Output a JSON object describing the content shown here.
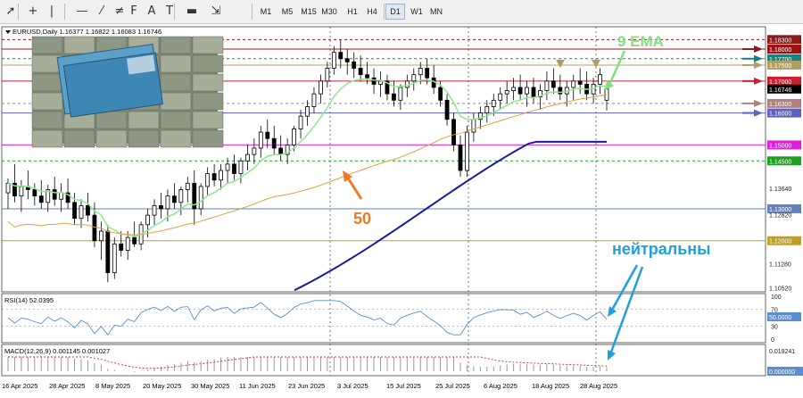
{
  "toolbar": {
    "tools": [
      {
        "name": "cursor-icon",
        "glyph": "➚"
      },
      {
        "name": "crosshair-icon",
        "glyph": "+"
      },
      {
        "name": "vertical-line-icon",
        "glyph": "|"
      },
      {
        "name": "horizontal-line-icon",
        "glyph": "—"
      },
      {
        "name": "trendline-icon",
        "glyph": "⁄"
      },
      {
        "name": "channel-icon",
        "glyph": "≠"
      },
      {
        "name": "fibonacci-icon",
        "glyph": "F"
      },
      {
        "name": "text-icon",
        "glyph": "A"
      },
      {
        "name": "label-icon",
        "glyph": "T"
      },
      {
        "name": "shapes-icon",
        "glyph": "▬"
      },
      {
        "name": "arrows-icon",
        "glyph": "⇲"
      }
    ],
    "timeframes": [
      "M1",
      "M5",
      "M15",
      "M30",
      "H1",
      "H4",
      "D1",
      "W1",
      "MN"
    ],
    "active_timeframe": "D1"
  },
  "chart_info": "EURUSD,Daily  1.16377 1.16822 1.16083 1.16746",
  "chart_data": {
    "type": "candlestick",
    "symbol": "EURUSD",
    "timeframe": "Daily",
    "ohlc_last": {
      "open": 1.16377,
      "high": 1.16822,
      "low": 1.16083,
      "close": 1.16746
    },
    "ylim": [
      1.104,
      1.187
    ],
    "x_labels": [
      "16 Apr 2025",
      "28 Apr 2025",
      "8 May 2025",
      "20 May 2025",
      "30 May 2025",
      "11 Jun 2025",
      "23 Jun 2025",
      "3 Jul 2025",
      "15 Jul 2025",
      "25 Jul 2025",
      "6 Aug 2025",
      "18 Aug 2025",
      "28 Aug 2025"
    ],
    "price_ticks": [
      1.1364,
      1.1282,
      1.1128,
      1.1052
    ],
    "candles": [
      [
        1.135,
        1.1395,
        1.13,
        1.138
      ],
      [
        1.138,
        1.144,
        1.132,
        1.134
      ],
      [
        1.134,
        1.139,
        1.129,
        1.137
      ],
      [
        1.137,
        1.142,
        1.133,
        1.136
      ],
      [
        1.136,
        1.138,
        1.131,
        1.134
      ],
      [
        1.134,
        1.139,
        1.13,
        1.132
      ],
      [
        1.132,
        1.1375,
        1.129,
        1.136
      ],
      [
        1.136,
        1.14,
        1.131,
        1.133
      ],
      [
        1.133,
        1.138,
        1.129,
        1.135
      ],
      [
        1.135,
        1.1395,
        1.13,
        1.132
      ],
      [
        1.132,
        1.135,
        1.125,
        1.127
      ],
      [
        1.127,
        1.133,
        1.124,
        1.131
      ],
      [
        1.131,
        1.135,
        1.126,
        1.128
      ],
      [
        1.128,
        1.132,
        1.118,
        1.12
      ],
      [
        1.12,
        1.126,
        1.114,
        1.123
      ],
      [
        1.123,
        1.125,
        1.107,
        1.11
      ],
      [
        1.11,
        1.121,
        1.108,
        1.119
      ],
      [
        1.119,
        1.123,
        1.115,
        1.117
      ],
      [
        1.117,
        1.123,
        1.114,
        1.121
      ],
      [
        1.121,
        1.126,
        1.118,
        1.119
      ],
      [
        1.119,
        1.126,
        1.117,
        1.125
      ],
      [
        1.125,
        1.13,
        1.121,
        1.128
      ],
      [
        1.128,
        1.133,
        1.125,
        1.131
      ],
      [
        1.131,
        1.135,
        1.127,
        1.13
      ],
      [
        1.13,
        1.136,
        1.126,
        1.134
      ],
      [
        1.134,
        1.138,
        1.13,
        1.132
      ],
      [
        1.132,
        1.137,
        1.128,
        1.136
      ],
      [
        1.136,
        1.14,
        1.132,
        1.138
      ],
      [
        1.138,
        1.142,
        1.125,
        1.13
      ],
      [
        1.13,
        1.138,
        1.128,
        1.137
      ],
      [
        1.137,
        1.143,
        1.134,
        1.141
      ],
      [
        1.141,
        1.144,
        1.137,
        1.139
      ],
      [
        1.139,
        1.144,
        1.136,
        1.142
      ],
      [
        1.142,
        1.146,
        1.138,
        1.144
      ],
      [
        1.144,
        1.147,
        1.139,
        1.141
      ],
      [
        1.141,
        1.146,
        1.138,
        1.145
      ],
      [
        1.145,
        1.15,
        1.142,
        1.147
      ],
      [
        1.147,
        1.152,
        1.144,
        1.149
      ],
      [
        1.149,
        1.156,
        1.146,
        1.154
      ],
      [
        1.154,
        1.158,
        1.149,
        1.152
      ],
      [
        1.152,
        1.156,
        1.147,
        1.149
      ],
      [
        1.149,
        1.153,
        1.145,
        1.147
      ],
      [
        1.147,
        1.152,
        1.144,
        1.15
      ],
      [
        1.15,
        1.156,
        1.148,
        1.155
      ],
      [
        1.155,
        1.161,
        1.152,
        1.159
      ],
      [
        1.159,
        1.164,
        1.156,
        1.162
      ],
      [
        1.162,
        1.168,
        1.16,
        1.166
      ],
      [
        1.166,
        1.172,
        1.163,
        1.17
      ],
      [
        1.17,
        1.176,
        1.168,
        1.174
      ],
      [
        1.174,
        1.181,
        1.172,
        1.179
      ],
      [
        1.179,
        1.183,
        1.174,
        1.177
      ],
      [
        1.177,
        1.18,
        1.172,
        1.176
      ],
      [
        1.176,
        1.179,
        1.171,
        1.174
      ],
      [
        1.174,
        1.178,
        1.17,
        1.172
      ],
      [
        1.172,
        1.176,
        1.169,
        1.171
      ],
      [
        1.171,
        1.174,
        1.166,
        1.169
      ],
      [
        1.169,
        1.173,
        1.165,
        1.17
      ],
      [
        1.17,
        1.172,
        1.164,
        1.166
      ],
      [
        1.166,
        1.17,
        1.162,
        1.164
      ],
      [
        1.164,
        1.169,
        1.161,
        1.168
      ],
      [
        1.168,
        1.172,
        1.165,
        1.17
      ],
      [
        1.17,
        1.174,
        1.167,
        1.172
      ],
      [
        1.172,
        1.176,
        1.169,
        1.174
      ],
      [
        1.174,
        1.177,
        1.169,
        1.171
      ],
      [
        1.171,
        1.175,
        1.166,
        1.168
      ],
      [
        1.168,
        1.17,
        1.162,
        1.164
      ],
      [
        1.164,
        1.166,
        1.156,
        1.158
      ],
      [
        1.158,
        1.16,
        1.148,
        1.15
      ],
      [
        1.15,
        1.153,
        1.14,
        1.142
      ],
      [
        1.142,
        1.156,
        1.14,
        1.154
      ],
      [
        1.154,
        1.16,
        1.151,
        1.158
      ],
      [
        1.158,
        1.162,
        1.155,
        1.16
      ],
      [
        1.16,
        1.164,
        1.157,
        1.162
      ],
      [
        1.162,
        1.166,
        1.159,
        1.164
      ],
      [
        1.164,
        1.168,
        1.161,
        1.166
      ],
      [
        1.166,
        1.17,
        1.163,
        1.167
      ],
      [
        1.167,
        1.171,
        1.164,
        1.168
      ],
      [
        1.168,
        1.172,
        1.164,
        1.166
      ],
      [
        1.166,
        1.17,
        1.162,
        1.168
      ],
      [
        1.168,
        1.171,
        1.163,
        1.165
      ],
      [
        1.165,
        1.169,
        1.161,
        1.167
      ],
      [
        1.167,
        1.173,
        1.164,
        1.17
      ],
      [
        1.17,
        1.174,
        1.166,
        1.168
      ],
      [
        1.168,
        1.172,
        1.164,
        1.166
      ],
      [
        1.166,
        1.17,
        1.162,
        1.168
      ],
      [
        1.168,
        1.172,
        1.164,
        1.17
      ],
      [
        1.17,
        1.174,
        1.166,
        1.169
      ],
      [
        1.169,
        1.173,
        1.164,
        1.166
      ],
      [
        1.166,
        1.171,
        1.163,
        1.169
      ],
      [
        1.169,
        1.174,
        1.166,
        1.172
      ],
      [
        1.164,
        1.1682,
        1.1608,
        1.1675
      ]
    ],
    "ema9_label": "9 EMA",
    "ma50_label": "50",
    "levels": [
      {
        "price": 1.183,
        "label": "1.18300",
        "color": "#8b1a1a",
        "style": "dash"
      },
      {
        "price": 1.18,
        "label": "1.18000",
        "color": "#a01010",
        "style": "solid"
      },
      {
        "price": 1.177,
        "label": "1.17700",
        "color": "#1a8080",
        "style": "dash"
      },
      {
        "price": 1.175,
        "label": "1.17500",
        "color": "#b0a060",
        "style": "solid"
      },
      {
        "price": 1.17,
        "label": "1.17000",
        "color": "#cc2030",
        "style": "solid"
      },
      {
        "price": 1.1675,
        "label": "1.16746",
        "color": "#000000",
        "style": "none"
      },
      {
        "price": 1.163,
        "label": "1.16300",
        "color": "#b08080",
        "style": "dash"
      },
      {
        "price": 1.16,
        "label": "1.16000",
        "color": "#6060c0",
        "style": "solid"
      },
      {
        "price": 1.15,
        "label": "1.15000",
        "color": "#e020e0",
        "style": "solid"
      },
      {
        "price": 1.145,
        "label": "1.14500",
        "color": "#20a020",
        "style": "dash"
      },
      {
        "price": 1.13,
        "label": "1.13000",
        "color": "#6080c0",
        "style": "solid"
      },
      {
        "price": 1.12,
        "label": "1.12000",
        "color": "#c0a020",
        "style": "solid"
      }
    ],
    "rsi": {
      "label": "RSI(14) 52.0395",
      "value": 52.0395,
      "value_label": "50.0000",
      "ticks": [
        "100",
        "70",
        "50",
        "30",
        "0"
      ]
    },
    "macd": {
      "label": "MACD(12,26,9) 0.001145 0.001027",
      "ticks": [
        "0.019241",
        "0.000000"
      ]
    },
    "annotation_neutral": "нейтральны"
  },
  "colors": {
    "candle": "#000000",
    "ema9": "#8ee88e",
    "ma50": "#e0a040",
    "ma200": "#1a1aa0",
    "annotation_blue": "#1ea0e0",
    "annotation_orange": "#f07820",
    "annotation_green": "#80e080"
  }
}
